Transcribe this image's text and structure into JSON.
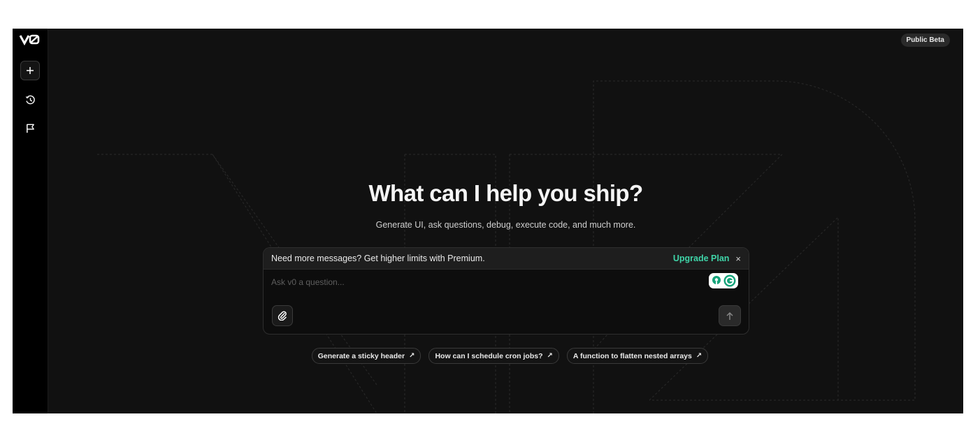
{
  "sidebar": {
    "logo_text": "v0",
    "new_chat_icon": "plus-icon",
    "history_icon": "clock-icon",
    "feedback_icon": "flag-icon"
  },
  "header": {
    "badge": "Public Beta"
  },
  "hero": {
    "title": "What can I help you ship?",
    "subtitle": "Generate UI, ask questions, debug, execute code, and much more."
  },
  "composer": {
    "promo_text": "Need more messages? Get higher limits with Premium.",
    "upgrade_label": "Upgrade Plan",
    "close_symbol": "×",
    "placeholder": "Ask v0 a question...",
    "value": "",
    "attach_icon": "paperclip-icon",
    "send_icon": "arrow-up-icon",
    "extension_icon": "grammarly-icon"
  },
  "suggestions": [
    {
      "label": "Generate a sticky header",
      "arrow": "↗"
    },
    {
      "label": "How can I schedule cron jobs?",
      "arrow": "↗"
    },
    {
      "label": "A function to flatten nested arrays",
      "arrow": "↗"
    }
  ],
  "colors": {
    "background": "#111111",
    "sidebar": "#000000",
    "accent": "#3fd4a8",
    "text": "#f5f5f5"
  }
}
